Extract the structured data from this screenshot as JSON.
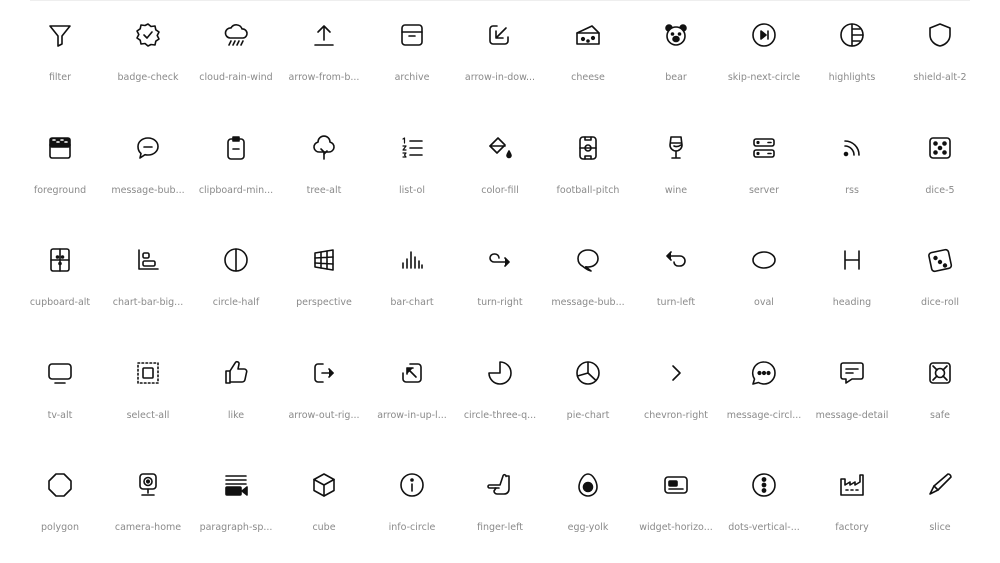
{
  "icons": [
    {
      "label": "filter",
      "icon": "filter-icon"
    },
    {
      "label": "badge-check",
      "icon": "badge-check-icon"
    },
    {
      "label": "cloud-rain-wind",
      "icon": "cloud-rain-wind-icon"
    },
    {
      "label": "arrow-from-b...",
      "icon": "arrow-from-bottom-icon"
    },
    {
      "label": "archive",
      "icon": "archive-icon"
    },
    {
      "label": "arrow-in-dow...",
      "icon": "arrow-in-down-left-icon"
    },
    {
      "label": "cheese",
      "icon": "cheese-icon"
    },
    {
      "label": "bear",
      "icon": "bear-icon"
    },
    {
      "label": "skip-next-circle",
      "icon": "skip-next-circle-icon"
    },
    {
      "label": "highlights",
      "icon": "highlights-icon"
    },
    {
      "label": "shield-alt-2",
      "icon": "shield-alt-2-icon"
    },
    {
      "label": "foreground",
      "icon": "foreground-icon"
    },
    {
      "label": "message-bub...",
      "icon": "message-bubble-icon"
    },
    {
      "label": "clipboard-min...",
      "icon": "clipboard-minus-icon"
    },
    {
      "label": "tree-alt",
      "icon": "tree-alt-icon"
    },
    {
      "label": "list-ol",
      "icon": "list-ol-icon"
    },
    {
      "label": "color-fill",
      "icon": "color-fill-icon"
    },
    {
      "label": "football-pitch",
      "icon": "football-pitch-icon"
    },
    {
      "label": "wine",
      "icon": "wine-icon"
    },
    {
      "label": "server",
      "icon": "server-icon"
    },
    {
      "label": "rss",
      "icon": "rss-icon"
    },
    {
      "label": "dice-5",
      "icon": "dice-5-icon"
    },
    {
      "label": "cupboard-alt",
      "icon": "cupboard-alt-icon"
    },
    {
      "label": "chart-bar-big...",
      "icon": "chart-bar-big-icon"
    },
    {
      "label": "circle-half",
      "icon": "circle-half-icon"
    },
    {
      "label": "perspective",
      "icon": "perspective-icon"
    },
    {
      "label": "bar-chart",
      "icon": "bar-chart-icon"
    },
    {
      "label": "turn-right",
      "icon": "turn-right-icon"
    },
    {
      "label": "message-bub...",
      "icon": "message-bubble-alt-icon"
    },
    {
      "label": "turn-left",
      "icon": "turn-left-icon"
    },
    {
      "label": "oval",
      "icon": "oval-icon"
    },
    {
      "label": "heading",
      "icon": "heading-icon"
    },
    {
      "label": "dice-roll",
      "icon": "dice-roll-icon"
    },
    {
      "label": "tv-alt",
      "icon": "tv-alt-icon"
    },
    {
      "label": "select-all",
      "icon": "select-all-icon"
    },
    {
      "label": "like",
      "icon": "like-icon"
    },
    {
      "label": "arrow-out-rig...",
      "icon": "arrow-out-right-icon"
    },
    {
      "label": "arrow-in-up-l...",
      "icon": "arrow-in-up-left-icon"
    },
    {
      "label": "circle-three-q...",
      "icon": "circle-three-quarter-icon"
    },
    {
      "label": "pie-chart",
      "icon": "pie-chart-icon"
    },
    {
      "label": "chevron-right",
      "icon": "chevron-right-icon"
    },
    {
      "label": "message-circl...",
      "icon": "message-circle-dots-icon"
    },
    {
      "label": "message-detail",
      "icon": "message-detail-icon"
    },
    {
      "label": "safe",
      "icon": "safe-icon"
    },
    {
      "label": "polygon",
      "icon": "polygon-icon"
    },
    {
      "label": "camera-home",
      "icon": "camera-home-icon"
    },
    {
      "label": "paragraph-sp...",
      "icon": "paragraph-spacing-icon"
    },
    {
      "label": "cube",
      "icon": "cube-icon"
    },
    {
      "label": "info-circle",
      "icon": "info-circle-icon"
    },
    {
      "label": "finger-left",
      "icon": "finger-left-icon"
    },
    {
      "label": "egg-yolk",
      "icon": "egg-yolk-icon"
    },
    {
      "label": "widget-horizo...",
      "icon": "widget-horizontal-icon"
    },
    {
      "label": "dots-vertical-...",
      "icon": "dots-vertical-rounded-icon"
    },
    {
      "label": "factory",
      "icon": "factory-icon"
    },
    {
      "label": "slice",
      "icon": "slice-icon"
    }
  ]
}
